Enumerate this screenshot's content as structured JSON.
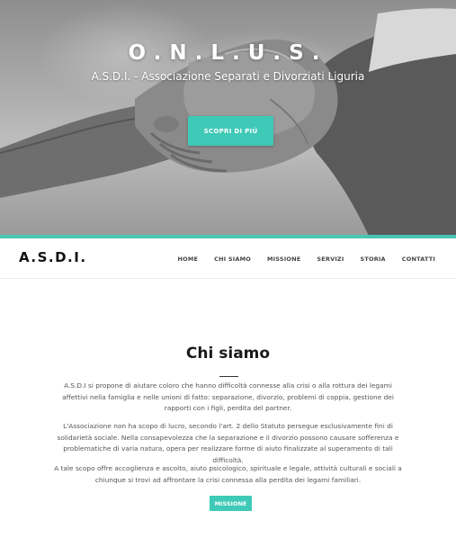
{
  "hero": {
    "title": "O.N.L.U.S.",
    "subtitle": "A.S.D.I. - Associazione Separati e Divorziati Liguria",
    "button_label": "SCOPRI DI PIÙ",
    "accent_color": "#3fc9b7"
  },
  "navbar": {
    "brand": "A.S.D.I.",
    "items": [
      {
        "label": "HOME"
      },
      {
        "label": "Chi siamo"
      },
      {
        "label": "Missione"
      },
      {
        "label": "Servizi"
      },
      {
        "label": "Storia"
      },
      {
        "label": "Contatti"
      }
    ]
  },
  "section": {
    "title": "Chi siamo",
    "paragraphs": [
      "A.S.D.I si propone di aiutare coloro che hanno difficoltà connesse alla crisi o alla rottura dei legami affettivi nella famiglia e nelle unioni di fatto: separazione, divorzio, problemi di coppia, gestione dei rapporti con i figli, perdita del partner.",
      "L'Associazione non ha scopo di lucro, secondo l'art. 2 dello Statuto persegue esclusivamente fini di solidarietà sociale. Nella consapevolezza che la separazione e il divorzio possono causare sofferenza e problematiche di varia natura, opera per realizzare forme di aiuto finalizzate al superamento di tali difficoltà.",
      "A tale scopo offre accoglienza e ascolto, aiuto psicologico, spirituale e legale, attività culturali e sociali a chiunque si trovi ad affrontare la crisi connessa alla perdita dei legami familiari."
    ],
    "button_label": "Missione"
  }
}
